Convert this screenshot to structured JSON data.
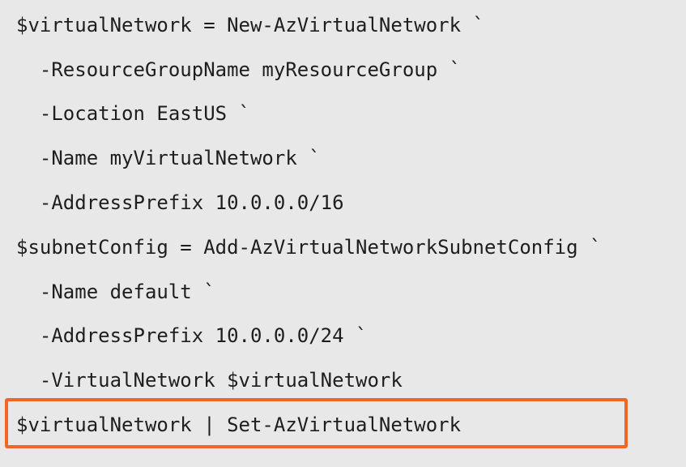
{
  "code": {
    "lines": [
      "$virtualNetwork = New-AzVirtualNetwork `",
      "  -ResourceGroupName myResourceGroup `",
      "  -Location EastUS `",
      "  -Name myVirtualNetwork `",
      "  -AddressPrefix 10.0.0.0/16",
      "$subnetConfig = Add-AzVirtualNetworkSubnetConfig `",
      "  -Name default `",
      "  -AddressPrefix 10.0.0.0/24 `",
      "  -VirtualNetwork $virtualNetwork",
      "$virtualNetwork | Set-AzVirtualNetwork"
    ],
    "highlighted_line_index": 9
  },
  "colors": {
    "background": "#e8e8e8",
    "text": "#1e1e1e",
    "highlight_border": "#f26522"
  }
}
